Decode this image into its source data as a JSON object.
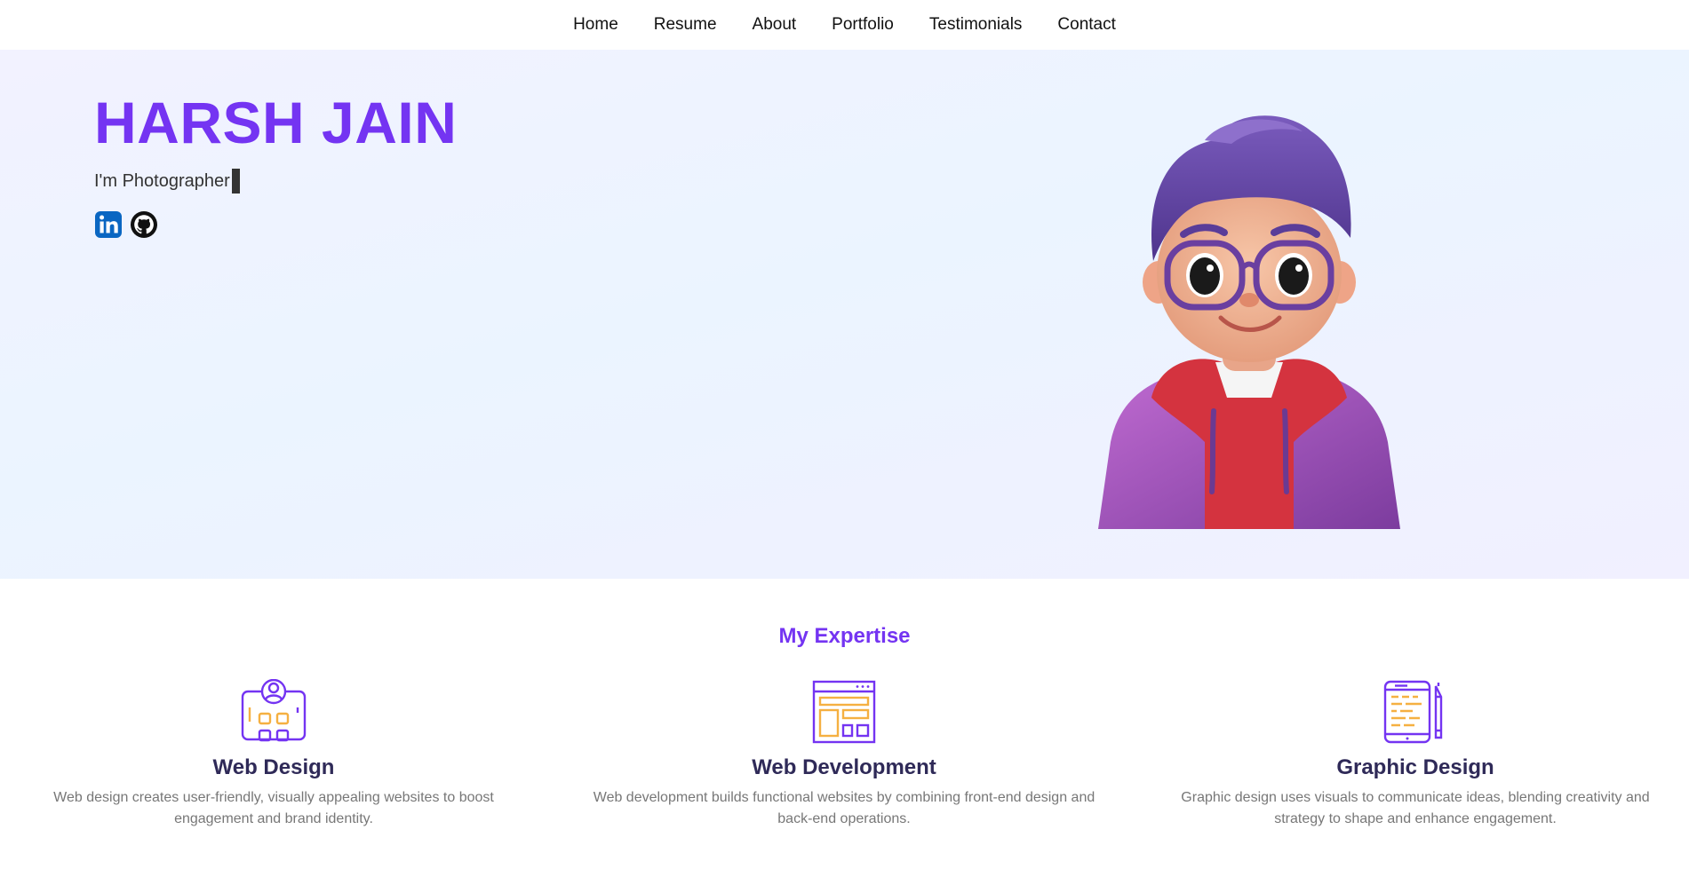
{
  "nav": {
    "items": [
      {
        "label": "Home"
      },
      {
        "label": "Resume"
      },
      {
        "label": "About"
      },
      {
        "label": "Portfolio"
      },
      {
        "label": "Testimonials"
      },
      {
        "label": "Contact"
      }
    ]
  },
  "hero": {
    "name": "HARSH JAIN",
    "role": "I'm Photographer",
    "socials": [
      {
        "icon": "linkedin-icon"
      },
      {
        "icon": "github-icon"
      }
    ]
  },
  "expertise": {
    "title": "My Expertise",
    "cards": [
      {
        "icon": "web-design-icon",
        "title": "Web Design",
        "description": "Web design creates user-friendly, visually appealing websites to boost engagement and brand identity."
      },
      {
        "icon": "web-development-icon",
        "title": "Web Development",
        "description": "Web development builds functional websites by combining front-end design and back-end operations."
      },
      {
        "icon": "graphic-design-icon",
        "title": "Graphic Design",
        "description": "Graphic design uses visuals to communicate ideas, blending creativity and strategy to shape and enhance engagement."
      }
    ]
  },
  "colors": {
    "accent": "#7434f2",
    "heading": "#2f2a58",
    "icon_orange": "#f5b041",
    "linkedin": "#0a66c2"
  }
}
